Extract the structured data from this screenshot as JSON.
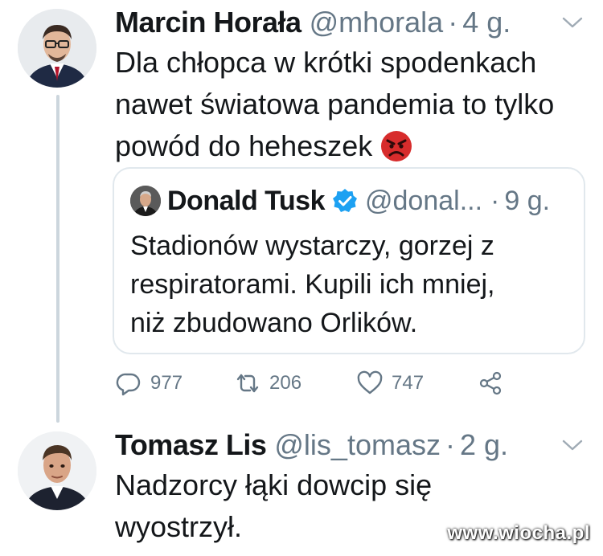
{
  "tweets": [
    {
      "display_name": "Marcin Horała",
      "handle": "@mhorala",
      "separator": "·",
      "time": "4 g.",
      "text": "Dla chłopca w krótki spodenkach\nnawet światowa pandemia to tylko\npowód do heheszek",
      "emoji": "angry-face-emoji",
      "quote": {
        "display_name": "Donald Tusk",
        "verified": true,
        "handle": "@donal...",
        "separator": "·",
        "time": "9 g.",
        "text": "Stadionów wystarczy, gorzej z\nrespiratorami. Kupili ich mniej,\nniż zbudowano Orlików."
      },
      "actions": {
        "replies": "977",
        "retweets": "206",
        "likes": "747"
      }
    },
    {
      "display_name": "Tomasz Lis",
      "handle": "@lis_tomasz",
      "separator": "·",
      "time": "2 g.",
      "text": "Nadzorcy łąki dowcip się\nwyostrzył."
    }
  ],
  "icons": {
    "reply": "reply-icon",
    "retweet": "retweet-icon",
    "like": "heart-icon",
    "share": "share-icon",
    "menu": "chevron-down-icon",
    "verified": "verified-badge-icon"
  },
  "colors": {
    "text": "#14171a",
    "secondary": "#657786",
    "border": "#e1e8ed",
    "verified": "#1da1f2",
    "thread_line": "#ccd6dd"
  },
  "watermark": "www.wiocha.pl"
}
